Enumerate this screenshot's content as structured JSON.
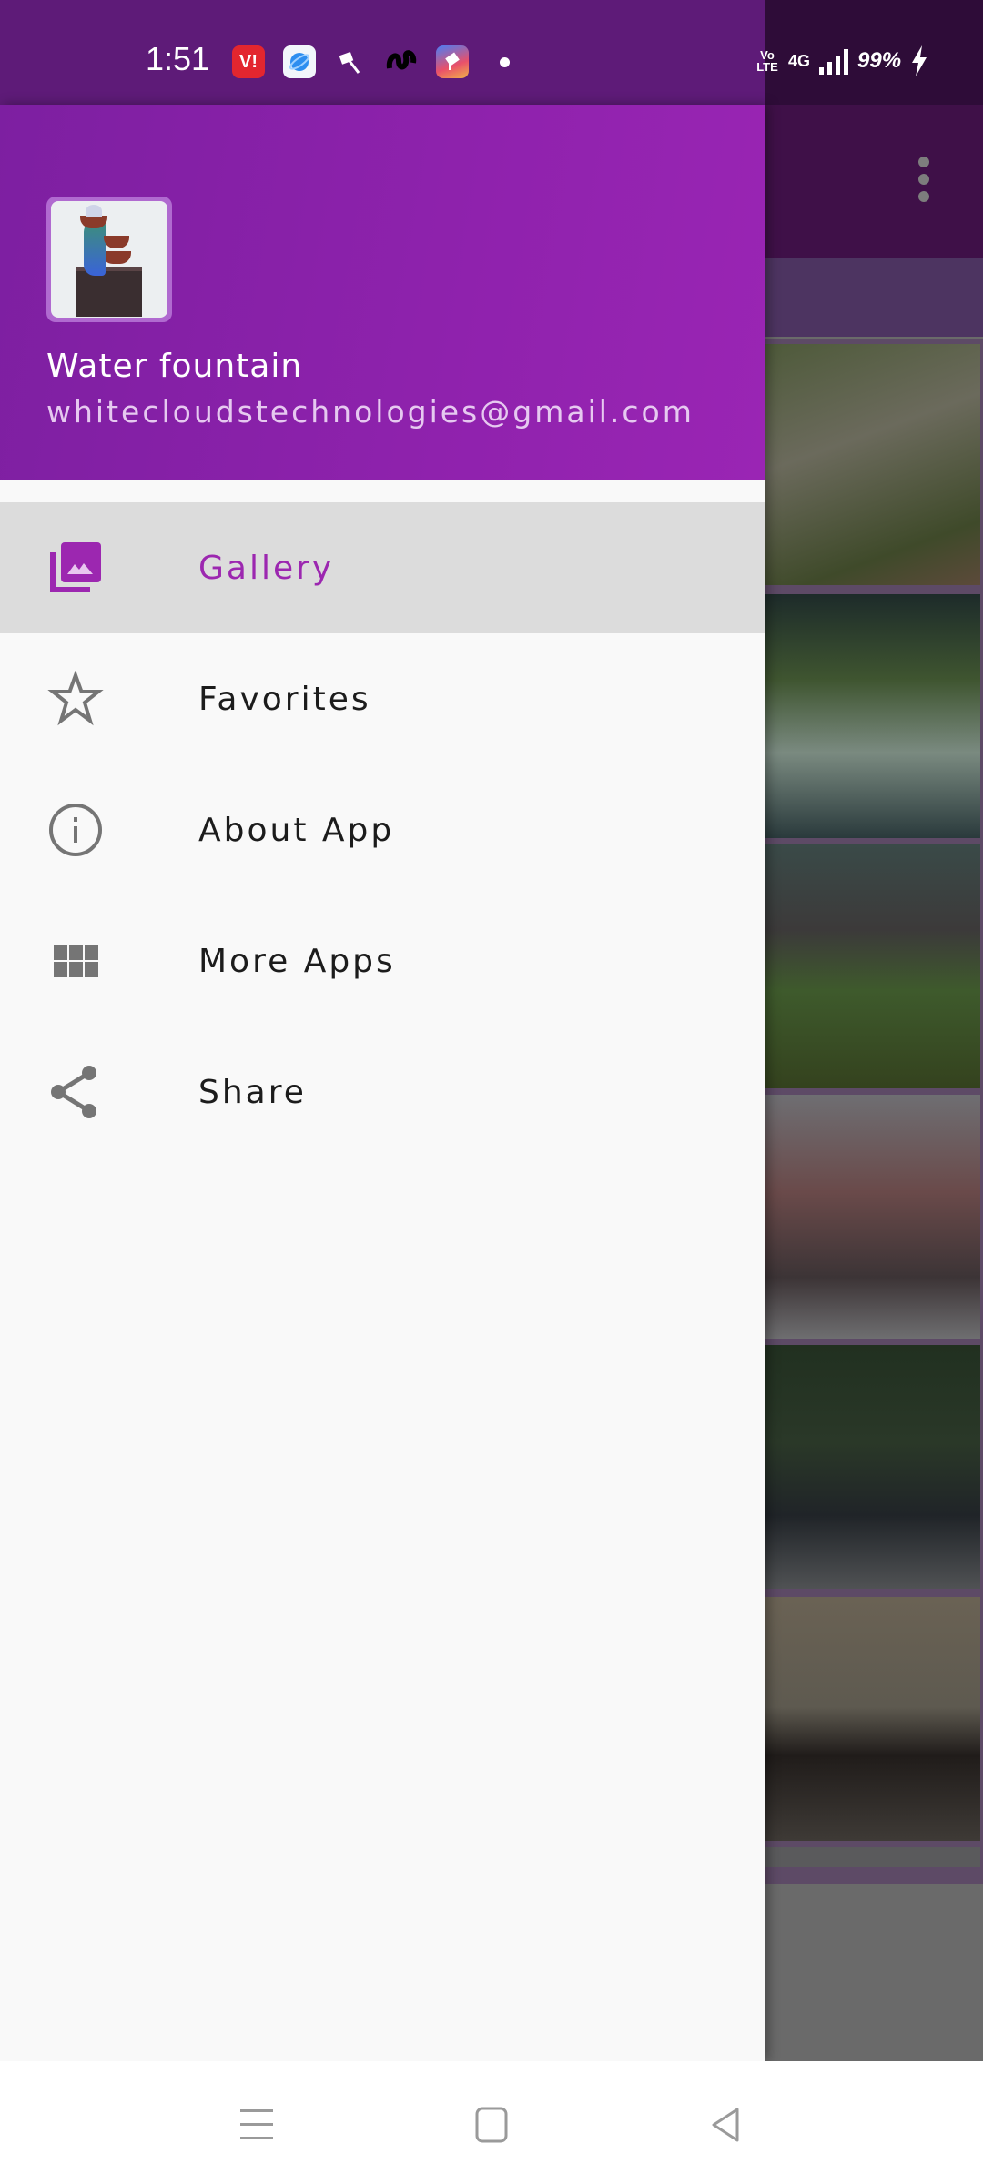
{
  "status_bar": {
    "time": "1:51",
    "notification_icons": [
      "vi-app-icon",
      "browser-app-icon",
      "tools-app-icon",
      "loop-app-icon",
      "store-app-icon"
    ],
    "network_volte": "Vo LTE",
    "network_type": "4G",
    "battery": "99%",
    "charging": true
  },
  "drawer": {
    "app_name": "Water fountain",
    "email": "whitecloudstechnologies@gmail.com",
    "items": [
      {
        "label": "Gallery",
        "icon": "gallery-icon",
        "active": true
      },
      {
        "label": "Favorites",
        "icon": "star-icon",
        "active": false
      },
      {
        "label": "About App",
        "icon": "info-icon",
        "active": false
      },
      {
        "label": "More Apps",
        "icon": "apps-grid-icon",
        "active": false
      },
      {
        "label": "Share",
        "icon": "share-icon",
        "active": false
      }
    ]
  },
  "background_app": {
    "overflow_menu_icon": "more-vert-icon",
    "gallery_images": [
      "tiered-green-pot-fountain",
      "waterfall-wall-fountain",
      "bird-bath-fountain",
      "tabletop-fountain",
      "plaza-fountain",
      "window-frame-fountain",
      "partial-fountain"
    ]
  },
  "nav_bar": {
    "buttons": [
      "recents",
      "home",
      "back"
    ]
  },
  "colors": {
    "accent": "#9c27b0",
    "header_gradient_start": "#7d1fa1",
    "header_gradient_end": "#9a25b4",
    "status_bar": "#5e1b78",
    "active_item_bg": "#dcdcdc",
    "icon_grey": "#757575"
  }
}
